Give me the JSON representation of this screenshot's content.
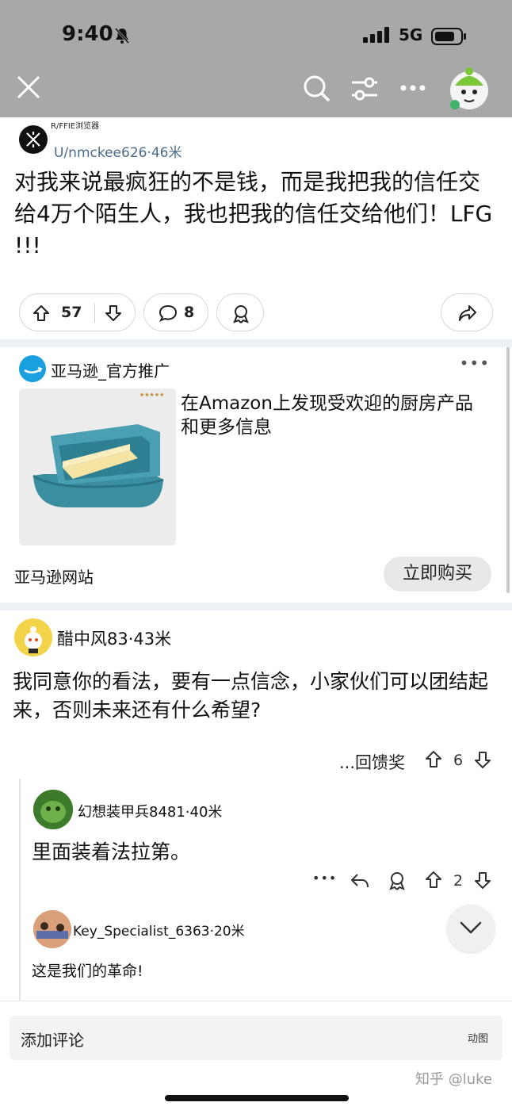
{
  "status_bar": {
    "time": "9:40",
    "network": "5G"
  },
  "post": {
    "subreddit": "R/FFIE浏览器",
    "user_meta": "U/nmckee626·46米",
    "title": "对我来说最疯狂的不是钱，而是我把我的信任交给4万个陌生人，我也把我的信任交给他们！LFG !!!",
    "upvotes": "57",
    "comments": "8"
  },
  "ad": {
    "advertiser": "亚马逊_官方推广",
    "more": "•••",
    "text": "在Amazon上发现受欢迎的厨房产品和更多信息",
    "site": "亚马逊网站",
    "cta": "立即购买"
  },
  "comments": [
    {
      "user_meta": "醋中风83·43米",
      "text": "我同意你的看法，要有一点信念，小家伙们可以团结起来，否则未来还有什么希望?",
      "award_label": "...回馈奖",
      "votes": "6"
    },
    {
      "user_meta": "幻想装甲兵8481·40米",
      "text": "里面装着法拉第。",
      "more": "•••",
      "votes": "2"
    },
    {
      "user_meta": "Key_Specialist_6363·20米",
      "text": "这是我们的革命!"
    }
  ],
  "composer": {
    "placeholder": "添加评论",
    "gif_label": "动图"
  },
  "watermark": "知乎 @luke"
}
